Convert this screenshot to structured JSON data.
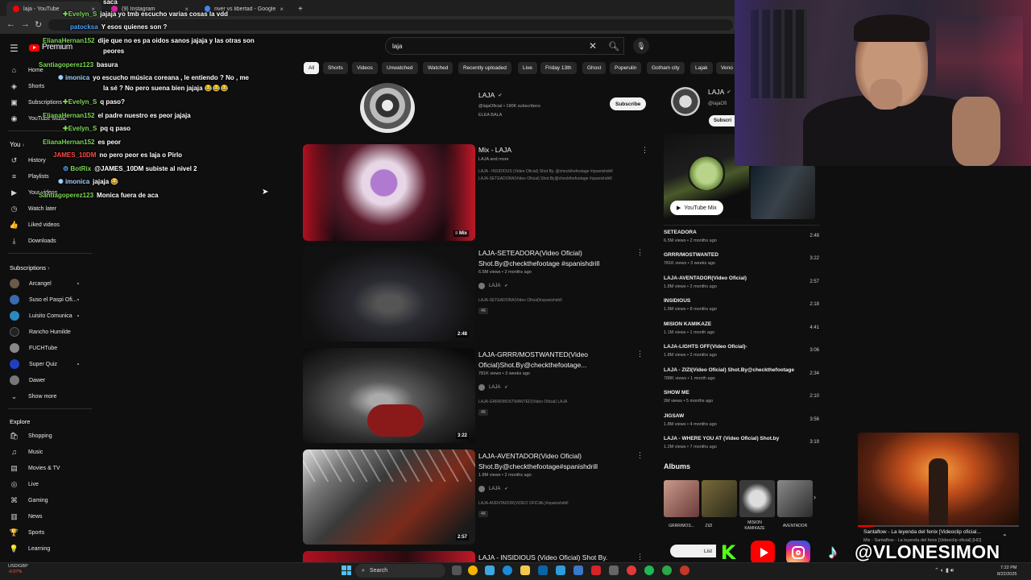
{
  "browser": {
    "tabs": [
      {
        "label": "laja - YouTube",
        "color": "#ff0000"
      },
      {
        "label": "(9) Instagram",
        "color": "#d6249f"
      },
      {
        "label": "river vs libertad - Google Search",
        "color": "#4285f4"
      }
    ],
    "new_tab": "+"
  },
  "youtube": {
    "logo_text": "Premium",
    "search_value": "laja",
    "sidebar": {
      "main": [
        {
          "label": "Home",
          "icon": "home-icon",
          "glyph": "⌂"
        },
        {
          "label": "Shorts",
          "icon": "shorts-icon",
          "glyph": "◈"
        },
        {
          "label": "Subscriptions",
          "icon": "subscriptions-icon",
          "glyph": "▣"
        },
        {
          "label": "YouTube Music",
          "icon": "music-icon",
          "glyph": "◉"
        }
      ],
      "you_header": "You",
      "you": [
        {
          "label": "History",
          "icon": "history-icon",
          "glyph": "↺"
        },
        {
          "label": "Playlists",
          "icon": "playlists-icon",
          "glyph": "≡"
        },
        {
          "label": "Your videos",
          "icon": "your-videos-icon",
          "glyph": "▶"
        },
        {
          "label": "Watch later",
          "icon": "watch-later-icon",
          "glyph": "◷"
        },
        {
          "label": "Liked videos",
          "icon": "liked-icon",
          "glyph": "👍"
        },
        {
          "label": "Downloads",
          "icon": "downloads-icon",
          "glyph": "⤓"
        }
      ],
      "subscriptions_header": "Subscriptions",
      "subscriptions": [
        {
          "label": "Arcangel",
          "color": "#6a5a4a"
        },
        {
          "label": "Suso el Paspi Ofi...",
          "color": "#3a6ab0"
        },
        {
          "label": "Luisito Comunica",
          "color": "#2a8ac0"
        },
        {
          "label": "Rancho Humilde",
          "color": "#222222"
        },
        {
          "label": "FUCHTube",
          "color": "#888888"
        },
        {
          "label": "Super Quiz",
          "color": "#2040c0"
        },
        {
          "label": "Dawer",
          "color": "#777777"
        }
      ],
      "show_more": "Show more",
      "explore_header": "Explore",
      "explore": [
        {
          "label": "Shopping",
          "icon": "shopping-icon",
          "glyph": "🛍"
        },
        {
          "label": "Music",
          "icon": "music-note-icon",
          "glyph": "♫"
        },
        {
          "label": "Movies & TV",
          "icon": "movies-icon",
          "glyph": "▤"
        },
        {
          "label": "Live",
          "icon": "live-icon",
          "glyph": "◎"
        },
        {
          "label": "Gaming",
          "icon": "gaming-icon",
          "glyph": "⌘"
        },
        {
          "label": "News",
          "icon": "news-icon",
          "glyph": "▥"
        },
        {
          "label": "Sports",
          "icon": "sports-icon",
          "glyph": "🏆"
        },
        {
          "label": "Learning",
          "icon": "learning-icon",
          "glyph": "💡"
        }
      ]
    },
    "chips": [
      "All",
      "Shorts",
      "Videos",
      "Unwatched",
      "Watched",
      "Recently uploaded",
      "Live",
      "Friday 13th",
      "Ghost",
      "Poperulin",
      "Gotham city",
      "Lajak",
      "Veno"
    ],
    "channel": {
      "name": "LAJA",
      "handle": "@lajaOficial • 190K subscribers",
      "desc": "ELEA BALA",
      "subscribe": "Subscribe"
    },
    "mix": {
      "title": "Mix - LAJA",
      "sub": "LAJA and more",
      "line1": "LAJA - INSIDIOUS (Video Oficial) Shot By. @checkthefootage #spanishdrill",
      "line2": "LAJA-SETEADORA(Video Oficial) Shot.By@checkthefootage #spanishdrill",
      "badge": "Mix"
    },
    "videos": [
      {
        "title": "LAJA-SETEADORA(Video Oficial) Shot.By@checkthefootage #spanishdrill",
        "meta": "6.5M views • 2 months ago",
        "channel": "LAJA",
        "desc": "LAJA-SETEADORA(Video Oficial)#spanishdrill",
        "badge": "4K",
        "duration": "2:48"
      },
      {
        "title": "LAJA-GRRR/MOSTWANTED(Video Oficial)Shot.By@checkthefootage...",
        "meta": "781K views • 3 weeks ago",
        "channel": "LAJA",
        "desc": "LAJA-GRRR/MOSTWANTED(Video Oficial) LAJA",
        "badge": "4K",
        "duration": "3:22"
      },
      {
        "title": "LAJA-AVENTADOR(Video Oficial) Shot.By@checkthefootage#spanishdrill",
        "meta": "1.8M views • 2 months ago",
        "channel": "LAJA",
        "desc": "LAJA-AVENTADOR(VIDEO OFICIAL)#spanishdrill",
        "badge": "4K",
        "duration": "2:57"
      },
      {
        "title": "LAJA - INSIDIOUS (Video Oficial) Shot By."
      }
    ],
    "right_panel": {
      "channel_name": "LAJA",
      "channel_handle": "@lajaOfi",
      "subscribe": "Subscri",
      "mix_button": "YouTube Mix",
      "tracks": [
        {
          "title": "SETEADORA",
          "meta": "6.5M views • 2 months ago",
          "duration": "2:48"
        },
        {
          "title": "GRRR/MOSTWANTED",
          "meta": "781K views • 3 weeks ago",
          "duration": "3:22"
        },
        {
          "title": "LAJA-AVENTADOR(Video Oficial)",
          "meta": "1.8M views • 2 months ago",
          "duration": "2:57"
        },
        {
          "title": "INSIDIOUS",
          "meta": "1.9M views • 8 months ago",
          "duration": "2:18"
        },
        {
          "title": "MISION KAMIKAZE",
          "meta": "1.1M views • 1 month ago",
          "duration": "4:41"
        },
        {
          "title": "LAJA-LIGHTS OFF(Video Oficial)-",
          "meta": "1.8M views • 2 months ago",
          "duration": "3:06"
        },
        {
          "title": "LAJA - ZIZI(Video Oficial) Shot.By@checkthefootage",
          "meta": "788K views • 1 month ago",
          "duration": "2:34"
        },
        {
          "title": "SHOW ME",
          "meta": "2M views • 5 months ago",
          "duration": "2:10"
        },
        {
          "title": "JIGSAW",
          "meta": "1.8M views • 4 months ago",
          "duration": "3:56"
        },
        {
          "title": "LAJA - WHERE YOU AT (Video Oficial) Shot.by",
          "meta": "1.2M views • 7 months ago",
          "duration": "3:19"
        }
      ],
      "albums_header": "Albums",
      "albums": [
        "GRRR/MOS...",
        "ZIZI",
        "MISION KAMIKAZE",
        "AVENTADOR"
      ],
      "listen": "List"
    }
  },
  "chat": [
    {
      "user": "saca",
      "msg": "",
      "color": "#ffffff"
    },
    {
      "user": "Evelyn_S",
      "msg": "jajaja yo tmb escucho varias cosas la vdd",
      "color": "#7ed957",
      "badge": "✚"
    },
    {
      "user": "patocksa",
      "msg": "Y esos quienes son ?",
      "color": "#4aa3ff"
    },
    {
      "user": "ElianaHernan152",
      "msg": "dije que no es pa oidos sanos jajaja y las otras son",
      "color": "#7ed957"
    },
    {
      "user": "",
      "msg": "peores",
      "color": "#ffffff"
    },
    {
      "user": "Santiagoperez123",
      "msg": "basura",
      "color": "#7ed957"
    },
    {
      "user": "imonica",
      "msg": "yo escucho música coreana , le entiendo ? No , me",
      "color": "#9fd0ff",
      "badge": "✺"
    },
    {
      "user": "",
      "msg": "la sé ? No pero suena bien jajaja 😂😂😂",
      "color": "#ffffff"
    },
    {
      "user": "Evelyn_S",
      "msg": "q paso?",
      "color": "#7ed957",
      "badge": "✚"
    },
    {
      "user": "ElianaHernan152",
      "msg": "el padre nuestro es peor jajaja",
      "color": "#7ed957"
    },
    {
      "user": "Evelyn_S",
      "msg": "pq q paso",
      "color": "#7ed957",
      "badge": "✚"
    },
    {
      "user": "ElianaHernan152",
      "msg": "es peor",
      "color": "#7ed957"
    },
    {
      "user": "JAMES_10DM",
      "msg": "no pero peor es laja o Pirlo",
      "color": "#ff4a4a"
    },
    {
      "user": "BotRix",
      "msg": "@JAMES_10DM subiste al nivel 2",
      "color": "#7ed957",
      "badge": "⚙"
    },
    {
      "user": "imonica",
      "msg": "jajaja 😂",
      "color": "#9fd0ff",
      "badge": "✺"
    },
    {
      "user": "Santiagoperez123",
      "msg": "Monica fuera de aca",
      "color": "#7ed957"
    }
  ],
  "mini_player": {
    "title": "Santaflow - La leyenda del fenix [Videoclip oficial...",
    "sub": "Mix - Santaflow - La leyenda del fenix [Videoclip oficial] [HD]",
    "progress": 0.1
  },
  "stream": {
    "handle": "@VLONESIMON",
    "kick_icon": "K"
  },
  "taskbar": {
    "ticker_pair": "USD/GBP",
    "ticker_change": "-0.07%",
    "search": "Search",
    "time": "7:22 PM",
    "date": "8/22/2025"
  }
}
